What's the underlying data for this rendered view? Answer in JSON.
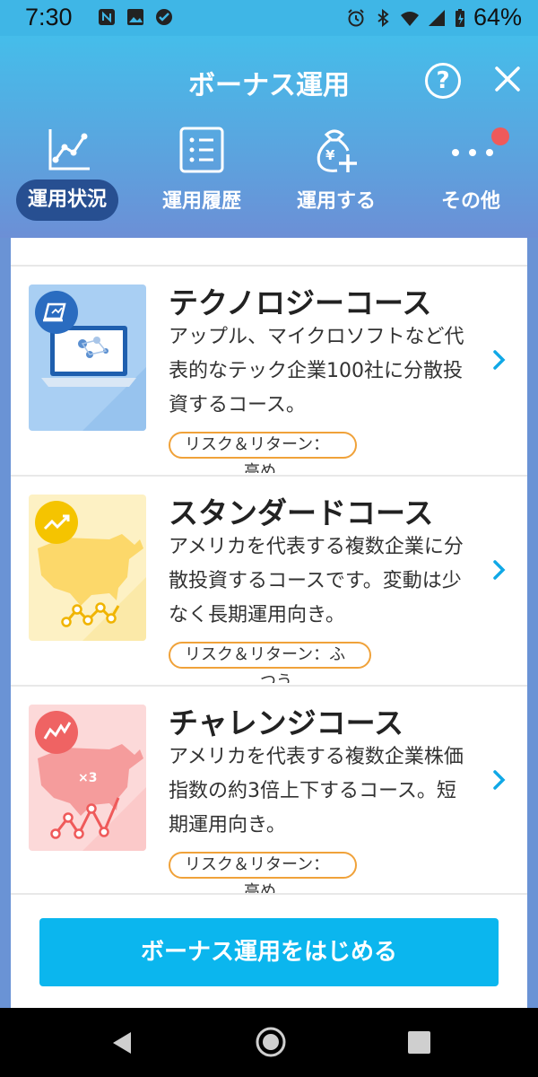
{
  "status_bar": {
    "time": "7:30",
    "battery": "64%"
  },
  "header": {
    "title": "ボーナス運用",
    "help_label": "?"
  },
  "tabs": [
    {
      "label": "運用状況",
      "icon": "line-chart-icon",
      "active": true
    },
    {
      "label": "運用履歴",
      "icon": "list-icon",
      "active": false
    },
    {
      "label": "運用する",
      "icon": "money-bag-add-icon",
      "active": false
    },
    {
      "label": "その他",
      "icon": "more-dots-icon",
      "active": false,
      "has_badge": true
    }
  ],
  "courses": [
    {
      "name": "テクノロジーコース",
      "description": "アップル、マイクロソフトなど代表的なテック企業100社に分散投資するコース。",
      "risk_label": "リスク＆リターン：",
      "risk_level": "高め",
      "thumb_color": "#a9cff3",
      "icon": "laptop-icon"
    },
    {
      "name": "スタンダードコース",
      "description": "アメリカを代表する複数企業に分散投資するコースです。変動は少なく長期運用向き。",
      "risk_label": "リスク＆リターン：ふ",
      "risk_level": "つう",
      "thumb_color": "#fdf1c4",
      "icon": "usa-map-icon"
    },
    {
      "name": "チャレンジコース",
      "description": "アメリカを代表する複数企業株価指数の約3倍上下するコース。短期運用向き。",
      "risk_label": "リスク＆リターン：",
      "risk_level": "高め",
      "thumb_color": "#fcd9d9",
      "icon": "usa-map-x3-icon"
    }
  ],
  "start_button": "ボーナス運用をはじめる",
  "colors": {
    "accent": "#0bb6ee",
    "active_tab": "#274f91",
    "risk_border": "#f0a23a",
    "badge": "#ef5a5a"
  }
}
